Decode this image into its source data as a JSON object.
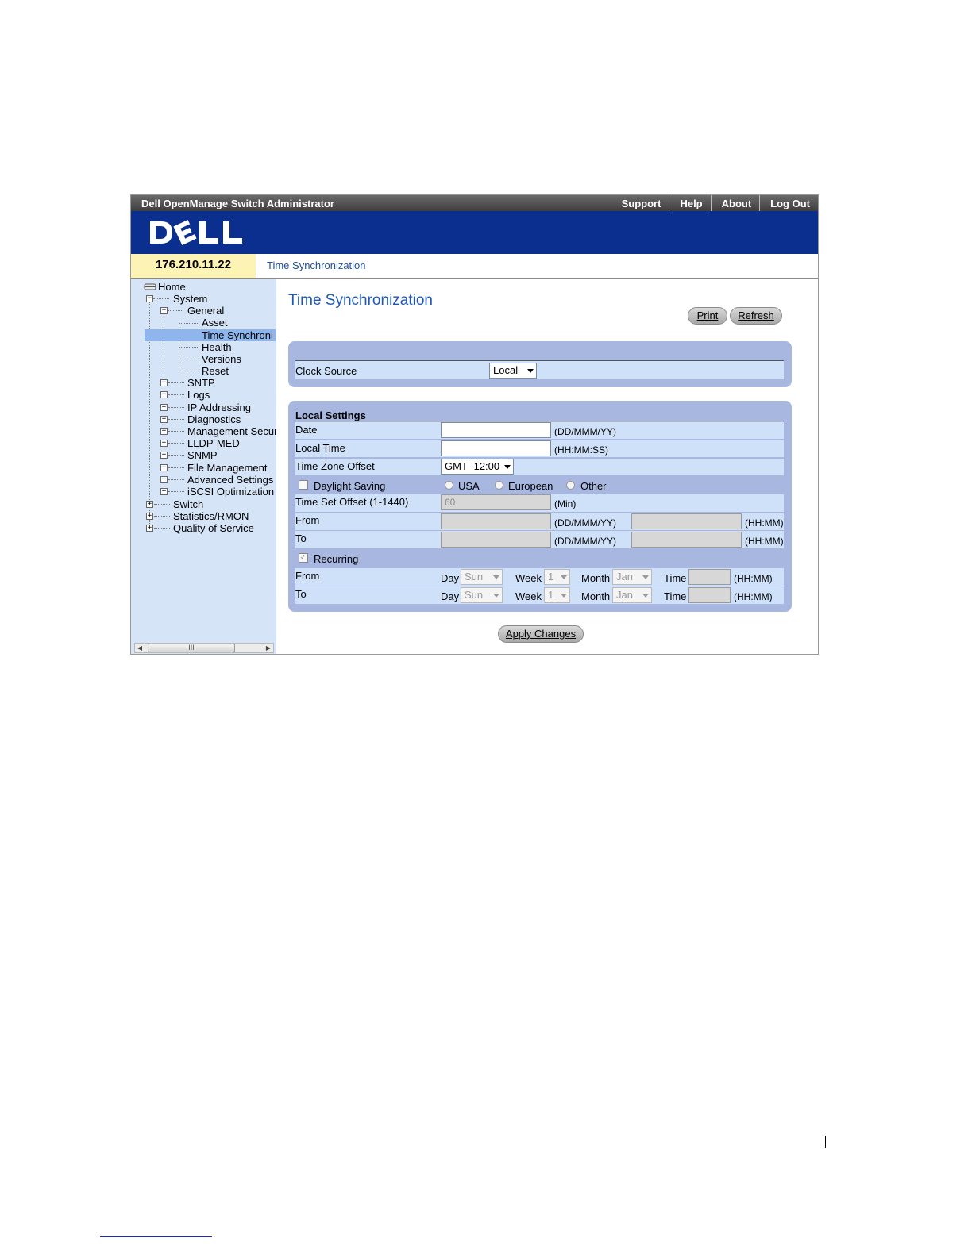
{
  "titlebar": {
    "title": "Dell OpenManage Switch Administrator"
  },
  "top_nav": [
    "Support",
    "Help",
    "About",
    "Log Out"
  ],
  "ip_address": "176.210.11.22",
  "breadcrumb": "Time Synchronization",
  "tree": {
    "home": "Home",
    "system": "System",
    "general": "General",
    "general_children": [
      "Asset",
      "Time Synchroni",
      "Health",
      "Versions",
      "Reset"
    ],
    "system_children": [
      "SNTP",
      "Logs",
      "IP Addressing",
      "Diagnostics",
      "Management Securit",
      "LLDP-MED",
      "SNMP",
      "File Management",
      "Advanced Settings",
      "iSCSI Optimization"
    ],
    "top_level": [
      "Switch",
      "Statistics/RMON",
      "Quality of Service"
    ],
    "scroll_thumb": "III"
  },
  "page_title": "Time Synchronization",
  "buttons": {
    "print": "Print",
    "refresh": "Refresh",
    "apply": "Apply Changes"
  },
  "clock_source": {
    "label": "Clock Source",
    "value": "Local"
  },
  "local_settings": {
    "header": "Local Settings",
    "date_label": "Date",
    "date_value": "",
    "date_unit": "(DD/MMM/YY)",
    "local_time_label": "Local Time",
    "local_time_value": "",
    "local_time_unit": "(HH:MM:SS)",
    "tz_label": "Time Zone Offset",
    "tz_value": "GMT -12:00",
    "dst_label": "Daylight Saving",
    "dst_options": [
      "USA",
      "European",
      "Other"
    ],
    "offset_label": "Time Set Offset (1-1440)",
    "offset_value": "60",
    "offset_unit": "(Min)",
    "from_label": "From",
    "to_label": "To",
    "date_fmt": "(DD/MMM/YY)",
    "time_fmt": "(HH:MM)",
    "recurring_label": "Recurring",
    "day_label": "Day",
    "week_label": "Week",
    "month_label": "Month",
    "time_label": "Time",
    "rec_from": {
      "day": "Sun",
      "week": "1",
      "month": "Jan"
    },
    "rec_to": {
      "day": "Sun",
      "week": "1",
      "month": "Jan"
    }
  }
}
